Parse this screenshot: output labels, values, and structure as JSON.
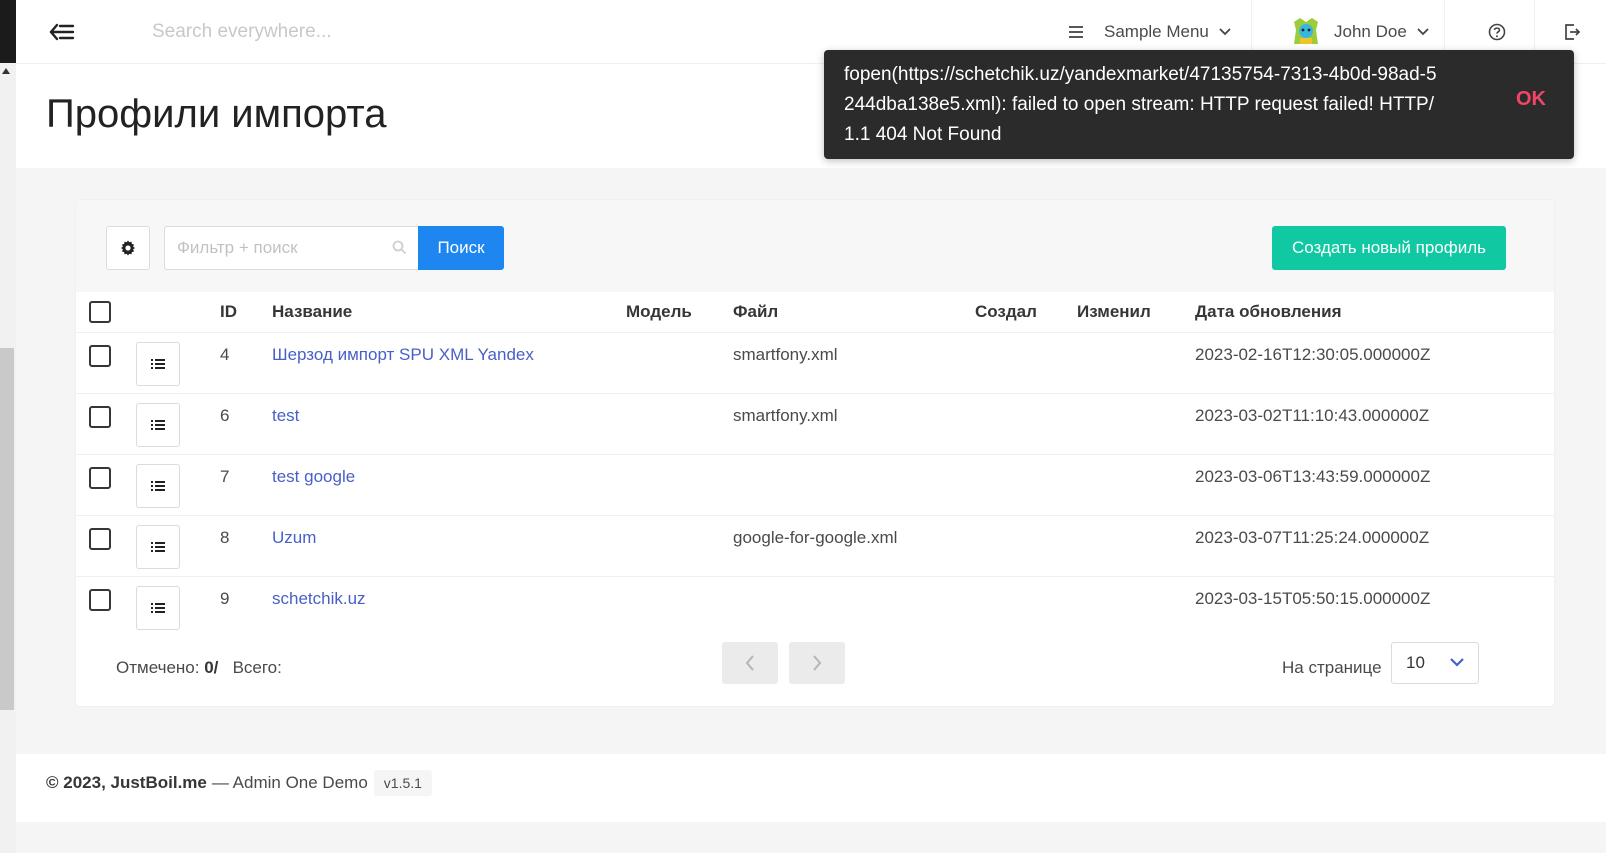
{
  "navbar": {
    "search_placeholder": "Search everywhere...",
    "menu_label": "Sample Menu",
    "user_name": "John Doe"
  },
  "page": {
    "title": "Профили импорта"
  },
  "toolbar": {
    "filter_placeholder": "Фильтр + поиск",
    "search_label": "Поиск",
    "create_label": "Создать новый профиль"
  },
  "table": {
    "headers": {
      "id": "ID",
      "name": "Название",
      "model": "Модель",
      "file": "Файл",
      "created_by": "Создал",
      "changed_by": "Изменил",
      "updated_at": "Дата обновления"
    },
    "rows": [
      {
        "id": "4",
        "name": "Шерзод импорт SPU XML Yandex",
        "model": "",
        "file": "smartfony.xml",
        "created_by": "",
        "changed_by": "",
        "updated_at": "2023-02-16T12:30:05.000000Z"
      },
      {
        "id": "6",
        "name": "test",
        "model": "",
        "file": "smartfony.xml",
        "created_by": "",
        "changed_by": "",
        "updated_at": "2023-03-02T11:10:43.000000Z"
      },
      {
        "id": "7",
        "name": "test google",
        "model": "",
        "file": "",
        "created_by": "",
        "changed_by": "",
        "updated_at": "2023-03-06T13:43:59.000000Z"
      },
      {
        "id": "8",
        "name": "Uzum",
        "model": "",
        "file": "google-for-google.xml",
        "created_by": "",
        "changed_by": "",
        "updated_at": "2023-03-07T11:25:24.000000Z"
      },
      {
        "id": "9",
        "name": "schetchik.uz",
        "model": "",
        "file": "",
        "created_by": "",
        "changed_by": "",
        "updated_at": "2023-03-15T05:50:15.000000Z"
      }
    ]
  },
  "pagination": {
    "checked_label": "Отмечено:",
    "checked_value": "0/",
    "total_label": "Всего:",
    "per_page_label": "На странице",
    "per_page_value": "10"
  },
  "footer": {
    "copyright": "© 2023, JustBoil.me",
    "product": "— Admin One Demo",
    "version": "v1.5.1"
  },
  "toast": {
    "message": "fopen(https://schetchik.uz/yandexmarket/47135754-7313-4b0d-98ad-5244dba138e5.xml): failed to open stream: HTTP request failed! HTTP/1.1 404 Not Found",
    "action": "OK"
  },
  "colors": {
    "primary": "#1d86f0",
    "success": "#10c9a3",
    "link": "#485fc7",
    "danger": "#f14668",
    "toast_bg": "#2b2b2b"
  },
  "icons": [
    "menu-back-icon",
    "hamburger-icon",
    "chevron-down-icon",
    "avatar",
    "help-circle-icon",
    "logout-icon",
    "gear-icon",
    "search-icon",
    "list-icon",
    "chevron-left-icon",
    "chevron-right-icon"
  ]
}
